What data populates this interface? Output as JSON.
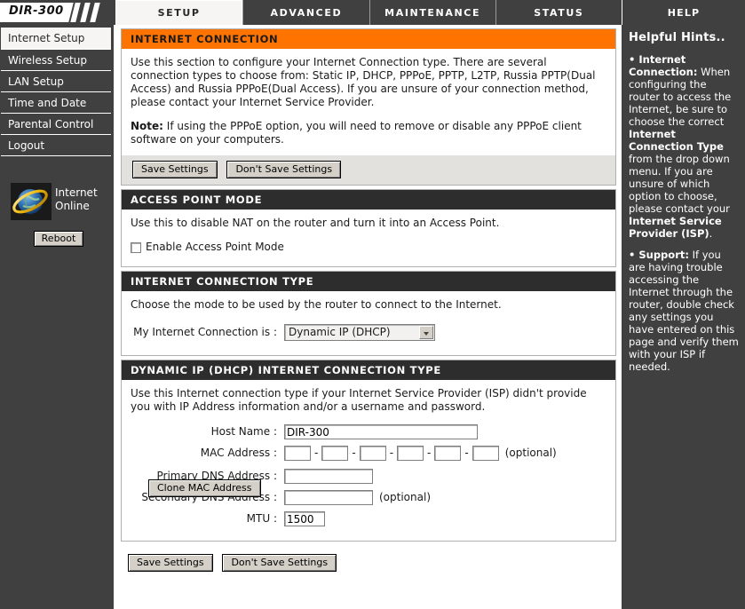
{
  "brand": {
    "model": "DIR-300"
  },
  "nav": {
    "tabs": [
      {
        "label": "SETUP",
        "active": true
      },
      {
        "label": "ADVANCED",
        "active": false
      },
      {
        "label": "MAINTENANCE",
        "active": false
      },
      {
        "label": "STATUS",
        "active": false
      },
      {
        "label": "HELP",
        "active": false
      }
    ]
  },
  "sidebar": {
    "items": [
      {
        "label": "Internet Setup",
        "selected": true
      },
      {
        "label": "Wireless Setup",
        "selected": false
      },
      {
        "label": "LAN Setup",
        "selected": false
      },
      {
        "label": "Time and Date",
        "selected": false
      },
      {
        "label": "Parental Control",
        "selected": false
      },
      {
        "label": "Logout",
        "selected": false
      }
    ],
    "status": {
      "line1": "Internet",
      "line2": "Online"
    },
    "reboot_label": "Reboot"
  },
  "internet_connection": {
    "header": "INTERNET CONNECTION",
    "paragraph": "Use this section to configure your Internet Connection type. There are several connection types to choose from: Static IP, DHCP, PPPoE, PPTP, L2TP, Russia PPTP(Dual Access) and Russia PPPoE(Dual Access). If you are unsure of your connection method, please contact your Internet Service Provider.",
    "note_label": "Note:",
    "note_text": " If using the PPPoE option, you will need to remove or disable any PPPoE client software on your computers.",
    "save_label": "Save Settings",
    "dont_save_label": "Don't Save Settings"
  },
  "access_point_mode": {
    "header": "ACCESS POINT MODE",
    "description": "Use this to disable NAT on the router and turn it into an Access Point.",
    "checkbox_label": "Enable Access Point Mode",
    "checked": false
  },
  "connection_type": {
    "header": "INTERNET CONNECTION TYPE",
    "description": "Choose the mode to be used by the router to connect to the Internet.",
    "field_label": "My Internet Connection is :",
    "selected": "Dynamic IP (DHCP)"
  },
  "dhcp": {
    "header": "DYNAMIC IP (DHCP) INTERNET CONNECTION TYPE",
    "description": "Use this Internet connection type if your Internet Service Provider (ISP) didn't provide you with IP Address information and/or a username and password.",
    "host_name_label": "Host Name :",
    "host_name_value": "DIR-300",
    "mac_label": "MAC Address :",
    "mac_octets": [
      "",
      "",
      "",
      "",
      "",
      ""
    ],
    "mac_separator": "-",
    "mac_optional": "(optional)",
    "clone_label": "Clone MAC Address",
    "primary_dns_label": "Primary DNS Address :",
    "primary_dns_value": "",
    "secondary_dns_label": "Secondary DNS Address :",
    "secondary_dns_value": "",
    "secondary_dns_optional": "(optional)",
    "mtu_label": "MTU :",
    "mtu_value": "1500"
  },
  "footer": {
    "save_label": "Save Settings",
    "dont_save_label": "Don't Save Settings"
  },
  "hints": {
    "title": "Helpful Hints..",
    "items": [
      {
        "bullet": "• ",
        "title": "Internet Connection:",
        "body_1": "When configuring the router to access the Internet, be sure to choose the correct ",
        "bold_1": "Internet Connection Type",
        "body_2": " from the drop down menu. If you are unsure of which option to choose, please contact your ",
        "bold_2": "Internet Service Provider (ISP)",
        "body_3": "."
      },
      {
        "bullet": "• ",
        "title": "Support:",
        "body_1": "If you are having trouble accessing the Internet through the router, double check any settings you have entered on this page and verify them with your ISP if needed.",
        "bold_1": "",
        "body_2": "",
        "bold_2": "",
        "body_3": ""
      }
    ]
  },
  "colors": {
    "accent_orange": "#ff7300",
    "panel_dark": "#2d2d2d",
    "chrome_dark": "#404040"
  }
}
